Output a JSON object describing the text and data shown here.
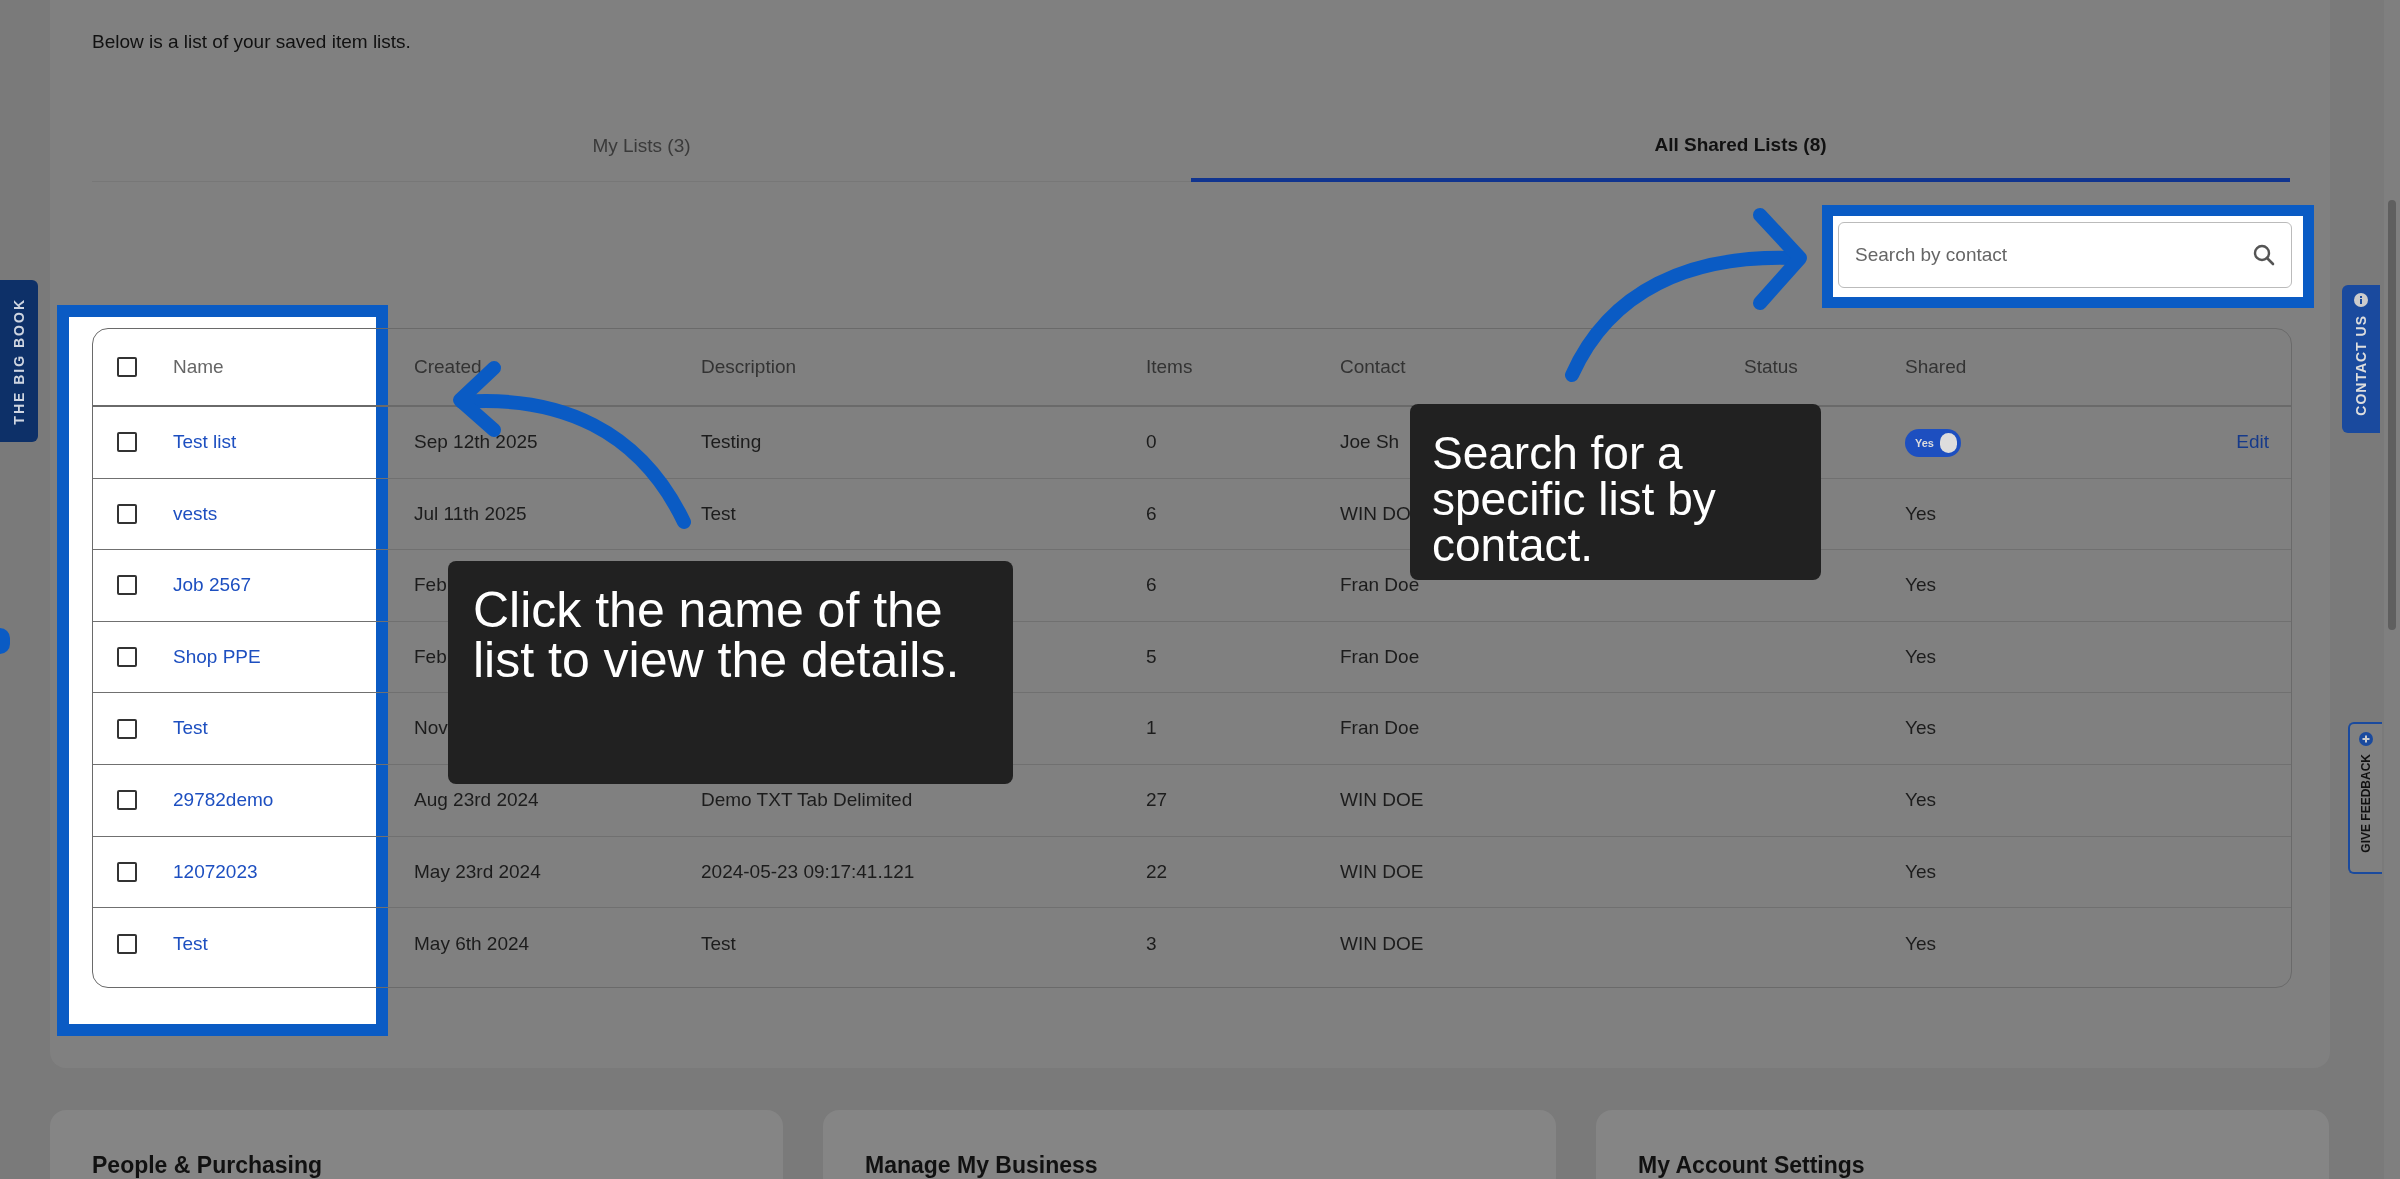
{
  "intro": "Below is a list of your saved item lists.",
  "tabs": [
    {
      "label": "My Lists (3)",
      "selected": false
    },
    {
      "label": "All Shared Lists (8)",
      "selected": true
    }
  ],
  "search": {
    "placeholder": "Search by contact"
  },
  "table": {
    "select_all_checked": false,
    "columns": [
      "Name",
      "Created",
      "Description",
      "Items",
      "Contact",
      "Status",
      "Shared"
    ],
    "rows": [
      {
        "checked": false,
        "name": "Test list",
        "created": "Sep 12th 2025",
        "description": "Testing",
        "items": "0",
        "contact": "Joe Sh",
        "shared": {
          "kind": "toggle",
          "on": true,
          "label": "Yes"
        },
        "action": "Edit"
      },
      {
        "checked": false,
        "name": "vests",
        "created": "Jul 11th 2025",
        "description": "Test",
        "items": "6",
        "contact": "WIN DO",
        "shared": {
          "kind": "text",
          "label": "Yes"
        }
      },
      {
        "checked": false,
        "name": "Job 2567",
        "created": "Feb",
        "items": "6",
        "contact": "Fran Doe",
        "shared": {
          "kind": "text",
          "label": "Yes"
        }
      },
      {
        "checked": false,
        "name": "Shop PPE",
        "created": "Feb",
        "items": "5",
        "contact": "Fran Doe",
        "shared": {
          "kind": "text",
          "label": "Yes"
        }
      },
      {
        "checked": false,
        "name": "Test",
        "created": "Nov",
        "items": "1",
        "contact": "Fran Doe",
        "shared": {
          "kind": "text",
          "label": "Yes"
        }
      },
      {
        "checked": false,
        "name": "29782demo",
        "created": "Aug 23rd 2024",
        "description": "Demo TXT Tab Delimited",
        "items": "27",
        "contact": "WIN DOE",
        "shared": {
          "kind": "text",
          "label": "Yes"
        }
      },
      {
        "checked": false,
        "name": "12072023",
        "created": "May 23rd 2024",
        "description": "2024-05-23 09:17:41.121",
        "items": "22",
        "contact": "WIN DOE",
        "shared": {
          "kind": "text",
          "label": "Yes"
        }
      },
      {
        "checked": false,
        "name": "Test",
        "created": "May 6th 2024",
        "description": "Test",
        "items": "3",
        "contact": "WIN DOE",
        "shared": {
          "kind": "text",
          "label": "Yes"
        }
      }
    ]
  },
  "callouts": [
    "Click the name of the list to view the details.",
    "Search for a specific list by contact."
  ],
  "cards": [
    "People & Purchasing",
    "Manage My Business",
    "My Account Settings"
  ],
  "side_tabs": {
    "left": "THE BIG BOOK",
    "contact": "CONTACT US",
    "feedback": "GIVE FEEDBACK"
  }
}
